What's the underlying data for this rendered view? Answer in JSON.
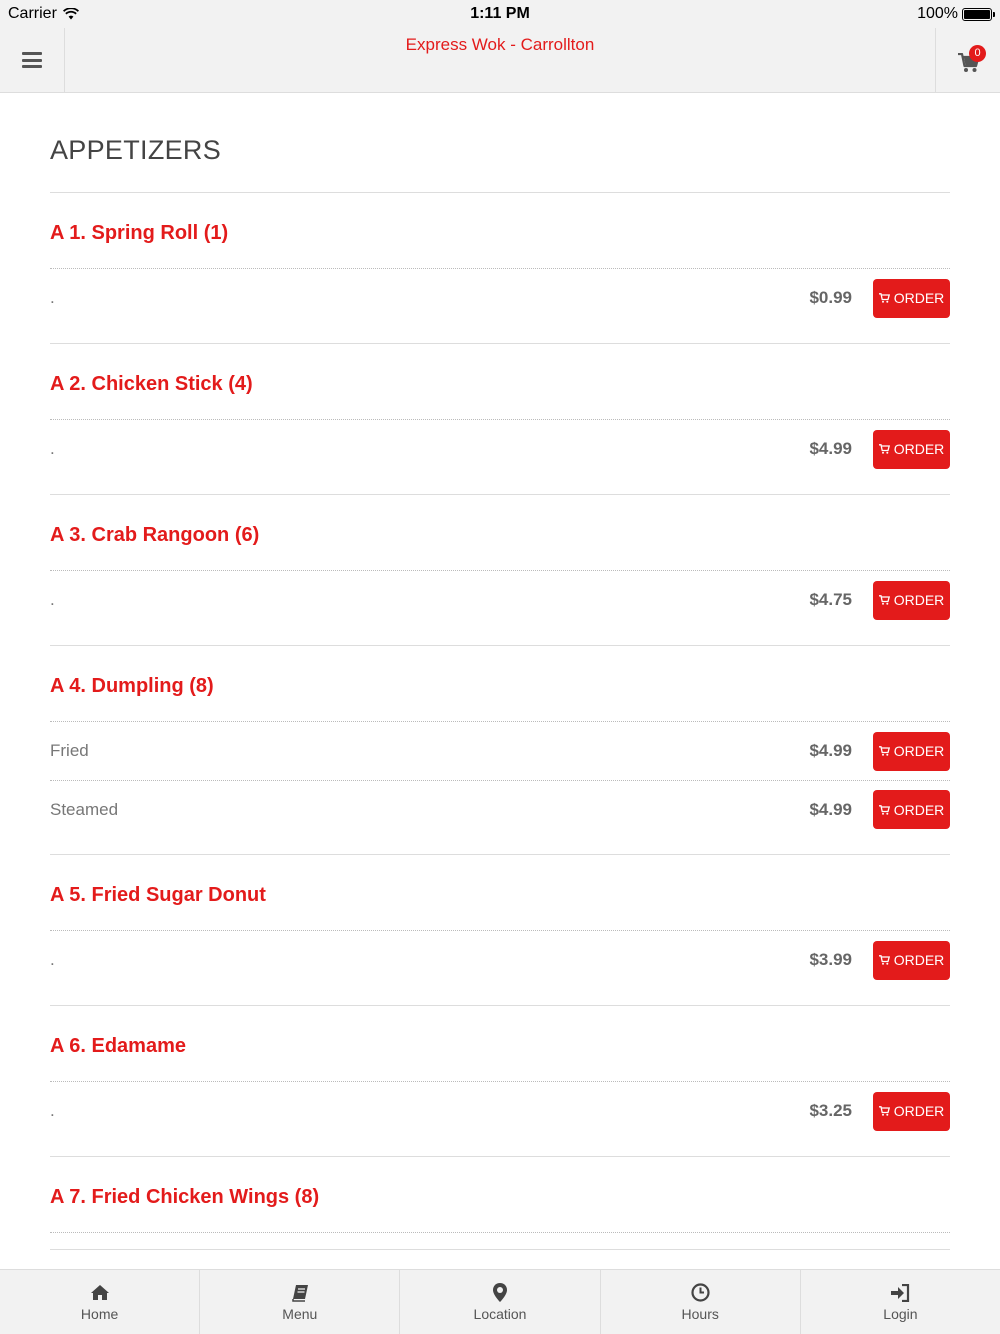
{
  "status_bar": {
    "carrier": "Carrier",
    "time": "1:11 PM",
    "battery": "100%"
  },
  "header": {
    "title": "Express Wok - Carrollton",
    "cart_count": "0"
  },
  "section": {
    "title": "APPETIZERS"
  },
  "order_label": "ORDER",
  "items": [
    {
      "name": "A 1. Spring Roll (1)",
      "variants": [
        {
          "label": ".",
          "price": "$0.99"
        }
      ]
    },
    {
      "name": "A 2. Chicken Stick (4)",
      "variants": [
        {
          "label": ".",
          "price": "$4.99"
        }
      ]
    },
    {
      "name": "A 3. Crab Rangoon (6)",
      "variants": [
        {
          "label": ".",
          "price": "$4.75"
        }
      ]
    },
    {
      "name": "A 4. Dumpling (8)",
      "variants": [
        {
          "label": "Fried",
          "price": "$4.99"
        },
        {
          "label": "Steamed",
          "price": "$4.99"
        }
      ]
    },
    {
      "name": "A 5. Fried Sugar Donut",
      "variants": [
        {
          "label": ".",
          "price": "$3.99"
        }
      ]
    },
    {
      "name": "A 6. Edamame",
      "variants": [
        {
          "label": ".",
          "price": "$3.25"
        }
      ]
    },
    {
      "name": "A 7. Fried Chicken Wings (8)",
      "variants": []
    }
  ],
  "tabs": [
    {
      "label": "Home",
      "icon": "home-icon"
    },
    {
      "label": "Menu",
      "icon": "book-icon"
    },
    {
      "label": "Location",
      "icon": "map-pin-icon"
    },
    {
      "label": "Hours",
      "icon": "clock-icon"
    },
    {
      "label": "Login",
      "icon": "sign-in-icon"
    }
  ],
  "colors": {
    "accent": "#e31b1b",
    "bar_background": "#f2f2f2"
  }
}
